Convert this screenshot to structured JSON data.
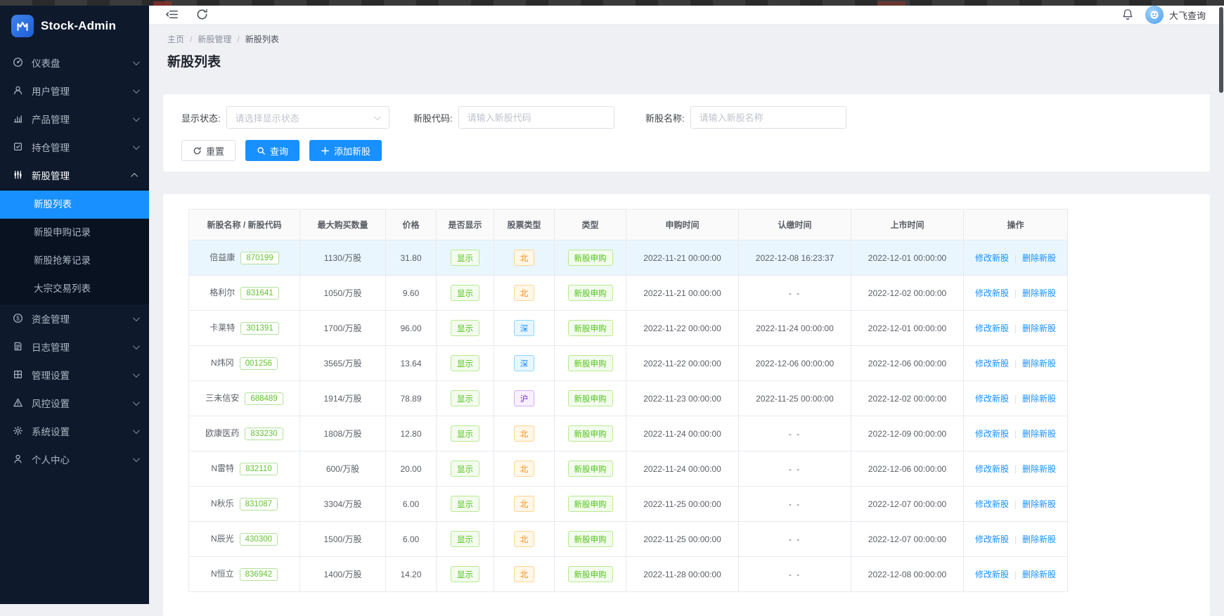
{
  "colors": {
    "accent": "#1890ff",
    "sidebar_bg": "#0e1a2c",
    "submenu_bg": "#081220",
    "active_item_bg": "#1890ff",
    "highlight_row_bg": "#e9f6fe",
    "badge_green": "#52c41a",
    "badge_orange": "#fa8c16",
    "badge_blue": "#1890ff",
    "badge_purple": "#722ed1"
  },
  "sidebar": {
    "logo_text": "Stock-Admin",
    "items": [
      {
        "key": "dashboard",
        "icon": "dashboard-icon",
        "label": "仪表盘"
      },
      {
        "key": "user-management",
        "icon": "user-icon",
        "label": "用户管理"
      },
      {
        "key": "product-management",
        "icon": "product-icon",
        "label": "产品管理"
      },
      {
        "key": "position-management",
        "icon": "position-icon",
        "label": "持仓管理"
      },
      {
        "key": "new-stock-management",
        "icon": "candlestick-icon",
        "label": "新股管理",
        "active": true,
        "expanded": true,
        "children": [
          {
            "key": "new-stock-list",
            "label": "新股列表",
            "active": true
          },
          {
            "key": "new-stock-subscribe-records",
            "label": "新股申购记录"
          },
          {
            "key": "new-stock-grab-records",
            "label": "新股抢筹记录"
          },
          {
            "key": "block-trade-list",
            "label": "大宗交易列表"
          }
        ]
      },
      {
        "key": "funds-management",
        "icon": "funds-icon",
        "label": "资金管理"
      },
      {
        "key": "log-management",
        "icon": "log-icon",
        "label": "日志管理"
      },
      {
        "key": "admin-settings",
        "icon": "grid-icon",
        "label": "管理设置"
      },
      {
        "key": "risk-settings",
        "icon": "warning-icon",
        "label": "风控设置"
      },
      {
        "key": "system-settings",
        "icon": "gear-icon",
        "label": "系统设置"
      },
      {
        "key": "personal-center",
        "icon": "person-icon",
        "label": "个人中心"
      }
    ]
  },
  "header": {
    "username": "大飞查询"
  },
  "breadcrumb": {
    "items": [
      "主页",
      "新股管理",
      "新股列表"
    ],
    "separator": "/"
  },
  "page_title": "新股列表",
  "filters": {
    "status_label": "显示状态:",
    "status_placeholder": "请选择显示状态",
    "code_label": "新股代码:",
    "code_placeholder": "请输入新股代码",
    "name_label": "新股名称:",
    "name_placeholder": "请输入新股名称",
    "reset_label": "重置",
    "search_label": "查询",
    "add_label": "添加新股"
  },
  "table": {
    "columns": [
      "新股名称 / 新股代码",
      "最大购买数量",
      "价格",
      "是否显示",
      "股票类型",
      "类型",
      "申购时间",
      "认缴时间",
      "上市时间",
      "操作"
    ],
    "actions": [
      "修改新股",
      "删除新股"
    ],
    "empty_time": "- -",
    "rows": [
      {
        "name": "倍益康",
        "code": "870199",
        "max": "1130/万股",
        "price": "31.80",
        "show": "显示",
        "market": "北",
        "market_color": "orange",
        "type": "新股申购",
        "apply_time": "2022-11-21 00:00:00",
        "pay_time": "2022-12-08 16:23:37",
        "list_time": "2022-12-01 00:00:00",
        "highlighted": true
      },
      {
        "name": "格利尔",
        "code": "831641",
        "max": "1050/万股",
        "price": "9.60",
        "show": "显示",
        "market": "北",
        "market_color": "orange",
        "type": "新股申购",
        "apply_time": "2022-11-21 00:00:00",
        "pay_time": "- -",
        "list_time": "2022-12-02 00:00:00"
      },
      {
        "name": "卡莱特",
        "code": "301391",
        "max": "1700/万股",
        "price": "96.00",
        "show": "显示",
        "market": "深",
        "market_color": "blue",
        "type": "新股申购",
        "apply_time": "2022-11-22 00:00:00",
        "pay_time": "2022-11-24 00:00:00",
        "list_time": "2022-12-01 00:00:00"
      },
      {
        "name": "N炜冈",
        "code": "001256",
        "max": "3565/万股",
        "price": "13.64",
        "show": "显示",
        "market": "深",
        "market_color": "blue",
        "type": "新股申购",
        "apply_time": "2022-11-22 00:00:00",
        "pay_time": "2022-12-06 00:00:00",
        "list_time": "2022-12-06 00:00:00"
      },
      {
        "name": "三未信安",
        "code": "688489",
        "max": "1914/万股",
        "price": "78.89",
        "show": "显示",
        "market": "沪",
        "market_color": "purple",
        "type": "新股申购",
        "apply_time": "2022-11-23 00:00:00",
        "pay_time": "2022-11-25 00:00:00",
        "list_time": "2022-12-02 00:00:00"
      },
      {
        "name": "欧康医药",
        "code": "833230",
        "max": "1808/万股",
        "price": "12.80",
        "show": "显示",
        "market": "北",
        "market_color": "orange",
        "type": "新股申购",
        "apply_time": "2022-11-24 00:00:00",
        "pay_time": "- -",
        "list_time": "2022-12-09 00:00:00"
      },
      {
        "name": "N雷特",
        "code": "832110",
        "max": "600/万股",
        "price": "20.00",
        "show": "显示",
        "market": "北",
        "market_color": "orange",
        "type": "新股申购",
        "apply_time": "2022-11-24 00:00:00",
        "pay_time": "- -",
        "list_time": "2022-12-06 00:00:00"
      },
      {
        "name": "N秋乐",
        "code": "831087",
        "max": "3304/万股",
        "price": "6.00",
        "show": "显示",
        "market": "北",
        "market_color": "orange",
        "type": "新股申购",
        "apply_time": "2022-11-25 00:00:00",
        "pay_time": "- -",
        "list_time": "2022-12-07 00:00:00"
      },
      {
        "name": "N辰光",
        "code": "430300",
        "max": "1500/万股",
        "price": "6.00",
        "show": "显示",
        "market": "北",
        "market_color": "orange",
        "type": "新股申购",
        "apply_time": "2022-11-25 00:00:00",
        "pay_time": "- -",
        "list_time": "2022-12-07 00:00:00"
      },
      {
        "name": "N恒立",
        "code": "836942",
        "max": "1400/万股",
        "price": "14.20",
        "show": "显示",
        "market": "北",
        "market_color": "orange",
        "type": "新股申购",
        "apply_time": "2022-11-28 00:00:00",
        "pay_time": "- -",
        "list_time": "2022-12-08 00:00:00"
      }
    ]
  }
}
